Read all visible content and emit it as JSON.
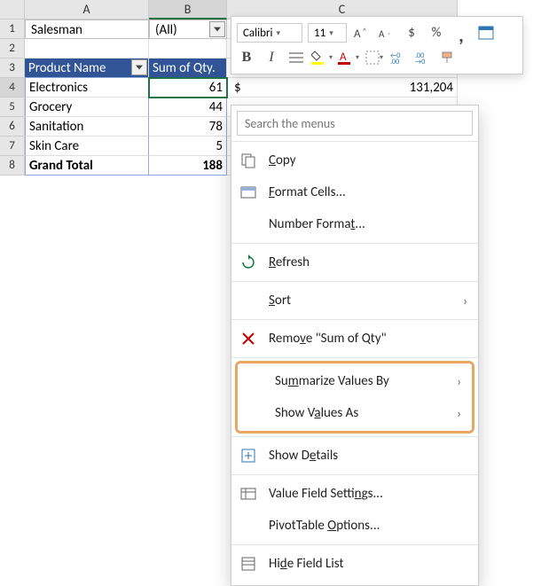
{
  "columns": {
    "A": "A",
    "B": "B",
    "C": "C"
  },
  "rowNums": [
    "1",
    "2",
    "3",
    "4",
    "5",
    "6",
    "7",
    "8"
  ],
  "filterRow": {
    "label": "Salesman",
    "value": "(All)"
  },
  "headers": {
    "a": "Product Name",
    "b": "Sum of Qty."
  },
  "rows": [
    {
      "name": "Electronics",
      "qty": "61"
    },
    {
      "name": "Grocery",
      "qty": "44"
    },
    {
      "name": "Sanitation",
      "qty": "78"
    },
    {
      "name": "Skin Care",
      "qty": "5"
    }
  ],
  "total": {
    "label": "Grand Total",
    "qty": "188"
  },
  "c4": {
    "prefix": "$",
    "value": "131,204"
  },
  "miniToolbar": {
    "font": "Calibri",
    "size": "11",
    "bold": "B",
    "italic": "I",
    "dollar": "$",
    "percent": "%",
    "comma": ","
  },
  "ctx": {
    "search_ph": "Search the menus",
    "copy": "Copy",
    "formatCells": "Format Cells...",
    "numberFormat": "Number Format...",
    "refresh": "Refresh",
    "sort": "Sort",
    "remove": "Remove \"Sum of Qty\"",
    "summarize": "Summarize Values By",
    "showAs": "Show Values As",
    "showDetails": "Show Details",
    "valueField": "Value Field Settings...",
    "pivotOptions": "PivotTable Options...",
    "hideField": "Hide Field List"
  }
}
